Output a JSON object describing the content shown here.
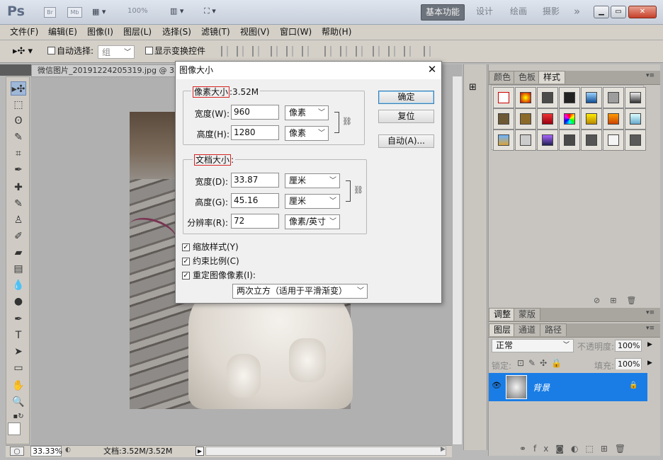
{
  "app": {
    "logo": "Ps",
    "titlebar": {
      "mini_icons": [
        "Br",
        "Mb"
      ],
      "zoom": "100%",
      "workspace_active": "基本功能",
      "workspaces": [
        "设计",
        "绘画",
        "摄影"
      ],
      "more": "»"
    }
  },
  "menu": [
    "文件(F)",
    "编辑(E)",
    "图像(I)",
    "图层(L)",
    "选择(S)",
    "滤镜(T)",
    "视图(V)",
    "窗口(W)",
    "帮助(H)"
  ],
  "options": {
    "auto_select_label": "自动选择:",
    "auto_select_value": "组",
    "show_transform_label": "显示变换控件"
  },
  "document": {
    "tab_title": "微信图片_20191224205319.jpg @ 33",
    "zoom_status": "33.33%",
    "doc_status": "文档:3.52M/3.52M"
  },
  "dialog": {
    "title": "图像大小",
    "pixel_dims": {
      "legend": "像素大小",
      "size": ":3.52M",
      "width_label": "宽度(W):",
      "width": "960",
      "width_unit": "像素",
      "height_label": "高度(H):",
      "height": "1280",
      "height_unit": "像素"
    },
    "doc_size": {
      "legend": "文档大小",
      "colon": ":",
      "width_label": "宽度(D):",
      "width": "33.87",
      "width_unit": "厘米",
      "height_label": "高度(G):",
      "height": "45.16",
      "height_unit": "厘米",
      "res_label": "分辨率(R):",
      "res": "72",
      "res_unit": "像素/英寸"
    },
    "checks": {
      "scale_styles": "缩放样式(Y)",
      "constrain": "约束比例(C)",
      "resample": "重定图像像素(I):"
    },
    "method": "两次立方（适用于平滑渐变）",
    "buttons": {
      "ok": "确定",
      "reset": "复位",
      "auto": "自动(A)..."
    },
    "close": "✕"
  },
  "panels": {
    "top_tabs": [
      "颜色",
      "色板",
      "样式"
    ],
    "adjust_tabs": [
      "调整",
      "蒙版"
    ],
    "layer_tabs": [
      "图层",
      "通道",
      "路径"
    ],
    "blend_mode": "正常",
    "opacity_label": "不透明度:",
    "opacity": "100%",
    "lock_label": "锁定:",
    "fill_label": "填充:",
    "fill": "100%",
    "layer_name": "背景"
  },
  "colors": {
    "accent": "#1a7de6",
    "dialog_red": "#d72323"
  }
}
